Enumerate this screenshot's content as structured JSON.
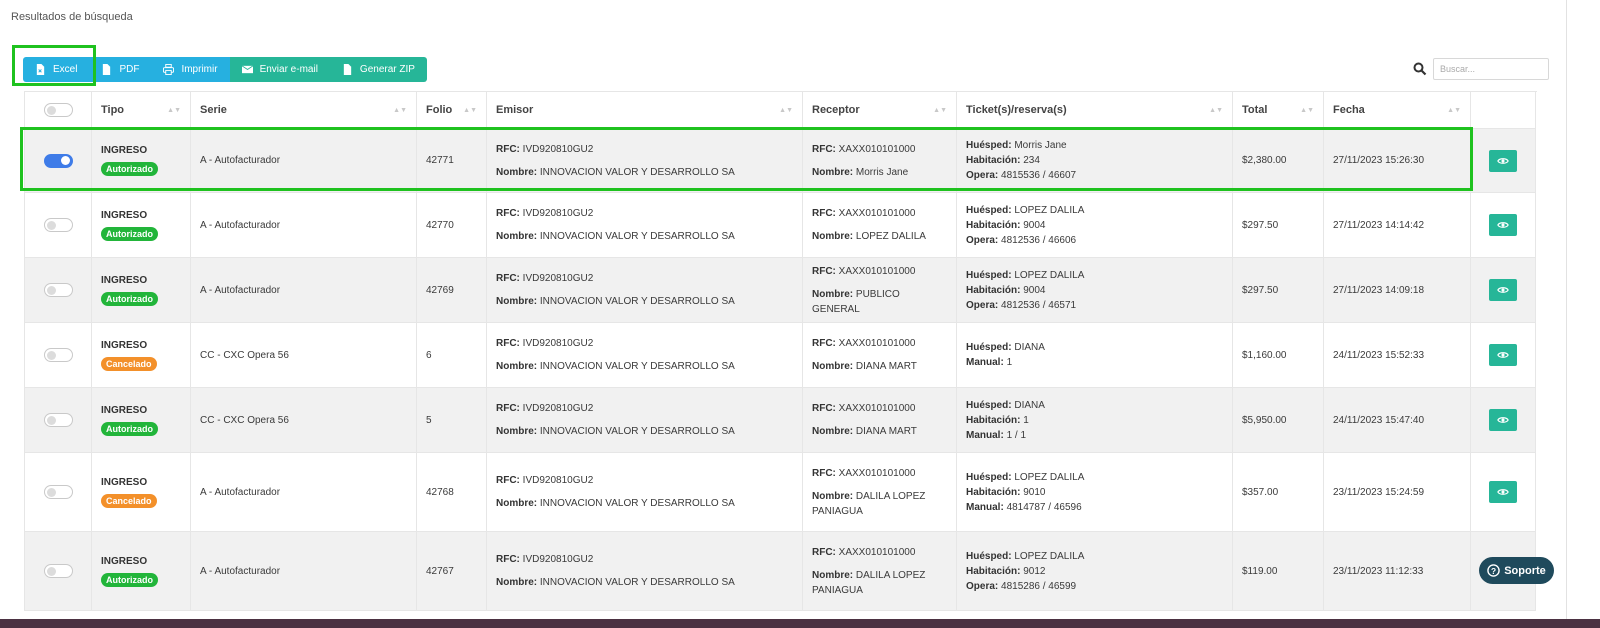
{
  "page_title": "Resultados de búsqueda",
  "toolbar": {
    "excel": "Excel",
    "pdf": "PDF",
    "print": "Imprimir",
    "email": "Enviar e-mail",
    "zip": "Generar ZIP"
  },
  "search": {
    "placeholder": "Buscar..."
  },
  "headers": [
    "Tipo",
    "Serie",
    "Folio",
    "Emisor",
    "Receptor",
    "Ticket(s)/reserva(s)",
    "Total",
    "Fecha"
  ],
  "labels": {
    "rfc": "RFC:",
    "nombre": "Nombre:",
    "huesped": "Huésped:",
    "habitacion": "Habitación:",
    "opera": "Opera:",
    "manual": "Manual:"
  },
  "rows": [
    {
      "selected": true,
      "tipo": "INGRESO",
      "status": "Autorizado",
      "serie": "A - Autofacturador",
      "folio": "42771",
      "emisor_rfc": "IVD920810GU2",
      "emisor_nombre": "INNOVACION VALOR Y DESARROLLO SA",
      "receptor_rfc": "XAXX010101000",
      "receptor_nombre": "Morris Jane",
      "huesped": "Morris Jane",
      "habitacion": "234",
      "ref_label": "opera",
      "ref_value": "4815536 / 46607",
      "total": "$2,380.00",
      "fecha": "27/11/2023 15:26:30"
    },
    {
      "selected": false,
      "tipo": "INGRESO",
      "status": "Autorizado",
      "serie": "A - Autofacturador",
      "folio": "42770",
      "emisor_rfc": "IVD920810GU2",
      "emisor_nombre": "INNOVACION VALOR Y DESARROLLO SA",
      "receptor_rfc": "XAXX010101000",
      "receptor_nombre": "LOPEZ DALILA",
      "huesped": "LOPEZ DALILA",
      "habitacion": "9004",
      "ref_label": "opera",
      "ref_value": "4812536 / 46606",
      "total": "$297.50",
      "fecha": "27/11/2023 14:14:42"
    },
    {
      "selected": false,
      "tipo": "INGRESO",
      "status": "Autorizado",
      "serie": "A - Autofacturador",
      "folio": "42769",
      "emisor_rfc": "IVD920810GU2",
      "emisor_nombre": "INNOVACION VALOR Y DESARROLLO SA",
      "receptor_rfc": "XAXX010101000",
      "receptor_nombre": "PUBLICO GENERAL",
      "huesped": "LOPEZ DALILA",
      "habitacion": "9004",
      "ref_label": "opera",
      "ref_value": "4812536 / 46571",
      "total": "$297.50",
      "fecha": "27/11/2023 14:09:18"
    },
    {
      "selected": false,
      "tipo": "INGRESO",
      "status": "Cancelado",
      "serie": "CC - CXC Opera 56",
      "folio": "6",
      "emisor_rfc": "IVD920810GU2",
      "emisor_nombre": "INNOVACION VALOR Y DESARROLLO SA",
      "receptor_rfc": "XAXX010101000",
      "receptor_nombre": "DIANA MART",
      "huesped": "DIANA",
      "habitacion": null,
      "ref_label": "manual",
      "ref_value": "1",
      "total": "$1,160.00",
      "fecha": "24/11/2023 15:52:33"
    },
    {
      "selected": false,
      "tipo": "INGRESO",
      "status": "Autorizado",
      "serie": "CC - CXC Opera 56",
      "folio": "5",
      "emisor_rfc": "IVD920810GU2",
      "emisor_nombre": "INNOVACION VALOR Y DESARROLLO SA",
      "receptor_rfc": "XAXX010101000",
      "receptor_nombre": "DIANA MART",
      "huesped": "DIANA",
      "habitacion": "1",
      "ref_label": "manual",
      "ref_value": "1 / 1",
      "total": "$5,950.00",
      "fecha": "24/11/2023 15:47:40"
    },
    {
      "selected": false,
      "tipo": "INGRESO",
      "status": "Cancelado",
      "serie": "A - Autofacturador",
      "folio": "42768",
      "emisor_rfc": "IVD920810GU2",
      "emisor_nombre": "INNOVACION VALOR Y DESARROLLO SA",
      "receptor_rfc": "XAXX010101000",
      "receptor_nombre": "DALILA LOPEZ PANIAGUA",
      "huesped": "LOPEZ DALILA",
      "habitacion": "9010",
      "ref_label": "manual",
      "ref_value": "4814787 / 46596",
      "total": "$357.00",
      "fecha": "23/11/2023 15:24:59"
    },
    {
      "selected": false,
      "tipo": "INGRESO",
      "status": "Autorizado",
      "serie": "A - Autofacturador",
      "folio": "42767",
      "emisor_rfc": "IVD920810GU2",
      "emisor_nombre": "INNOVACION VALOR Y DESARROLLO SA",
      "receptor_rfc": "XAXX010101000",
      "receptor_nombre": "DALILA LOPEZ PANIAGUA",
      "huesped": "LOPEZ DALILA",
      "habitacion": "9012",
      "ref_label": "opera",
      "ref_value": "4815286 / 46599",
      "total": "$119.00",
      "fecha": "23/11/2023 11:12:33"
    }
  ],
  "support": {
    "label": "Soporte"
  },
  "colors": {
    "blue_button": "#26b0e0",
    "green_button": "#26b698",
    "authorized": "#22b53a",
    "cancelled": "#f3902a",
    "toggle_on": "#3f7ce8",
    "highlight": "#1fc21f"
  }
}
